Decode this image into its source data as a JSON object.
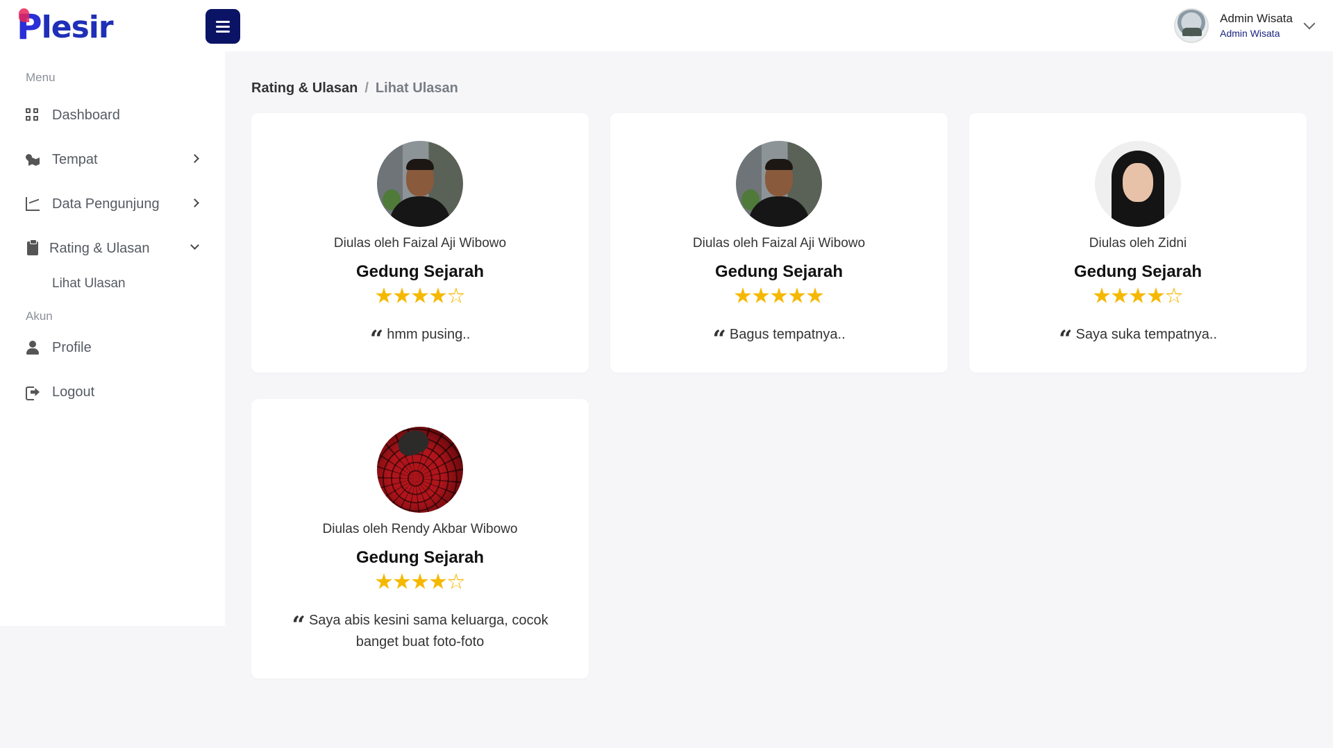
{
  "app": {
    "logo_first": "P",
    "logo_rest": "lesir"
  },
  "header": {
    "user_name": "Admin Wisata",
    "user_role": "Admin Wisata"
  },
  "sidebar": {
    "menu_heading": "Menu",
    "account_heading": "Akun",
    "items": [
      {
        "label": "Dashboard"
      },
      {
        "label": "Tempat"
      },
      {
        "label": "Data Pengunjung"
      },
      {
        "label": "Rating & Ulasan"
      },
      {
        "label": "Lihat Ulasan"
      },
      {
        "label": "Profile"
      },
      {
        "label": "Logout"
      }
    ]
  },
  "breadcrumb": {
    "parent": "Rating & Ulasan",
    "separator": "/",
    "current": "Lihat Ulasan"
  },
  "reviews": [
    {
      "reviewer": "Diulas oleh Faizal Aji Wibowo",
      "place": "Gedung Sejarah",
      "rating": 4,
      "comment": "hmm pusing..",
      "avatar": "man-photo"
    },
    {
      "reviewer": "Diulas oleh Faizal Aji Wibowo",
      "place": "Gedung Sejarah",
      "rating": 5,
      "comment": "Bagus tempatnya..",
      "avatar": "man-photo"
    },
    {
      "reviewer": "Diulas oleh Zidni",
      "place": "Gedung Sejarah",
      "rating": 4,
      "comment": "Saya suka tempatnya..",
      "avatar": "woman-photo"
    },
    {
      "reviewer": "Diulas oleh Rendy Akbar Wibowo",
      "place": "Gedung Sejarah",
      "rating": 4,
      "comment": "Saya abis kesini sama keluarga, cocok banget buat foto-foto",
      "avatar": "spiderman-photo"
    }
  ],
  "colors": {
    "accent_dark": "#0b1464",
    "star": "#f5b800",
    "background": "#f6f6f9"
  }
}
